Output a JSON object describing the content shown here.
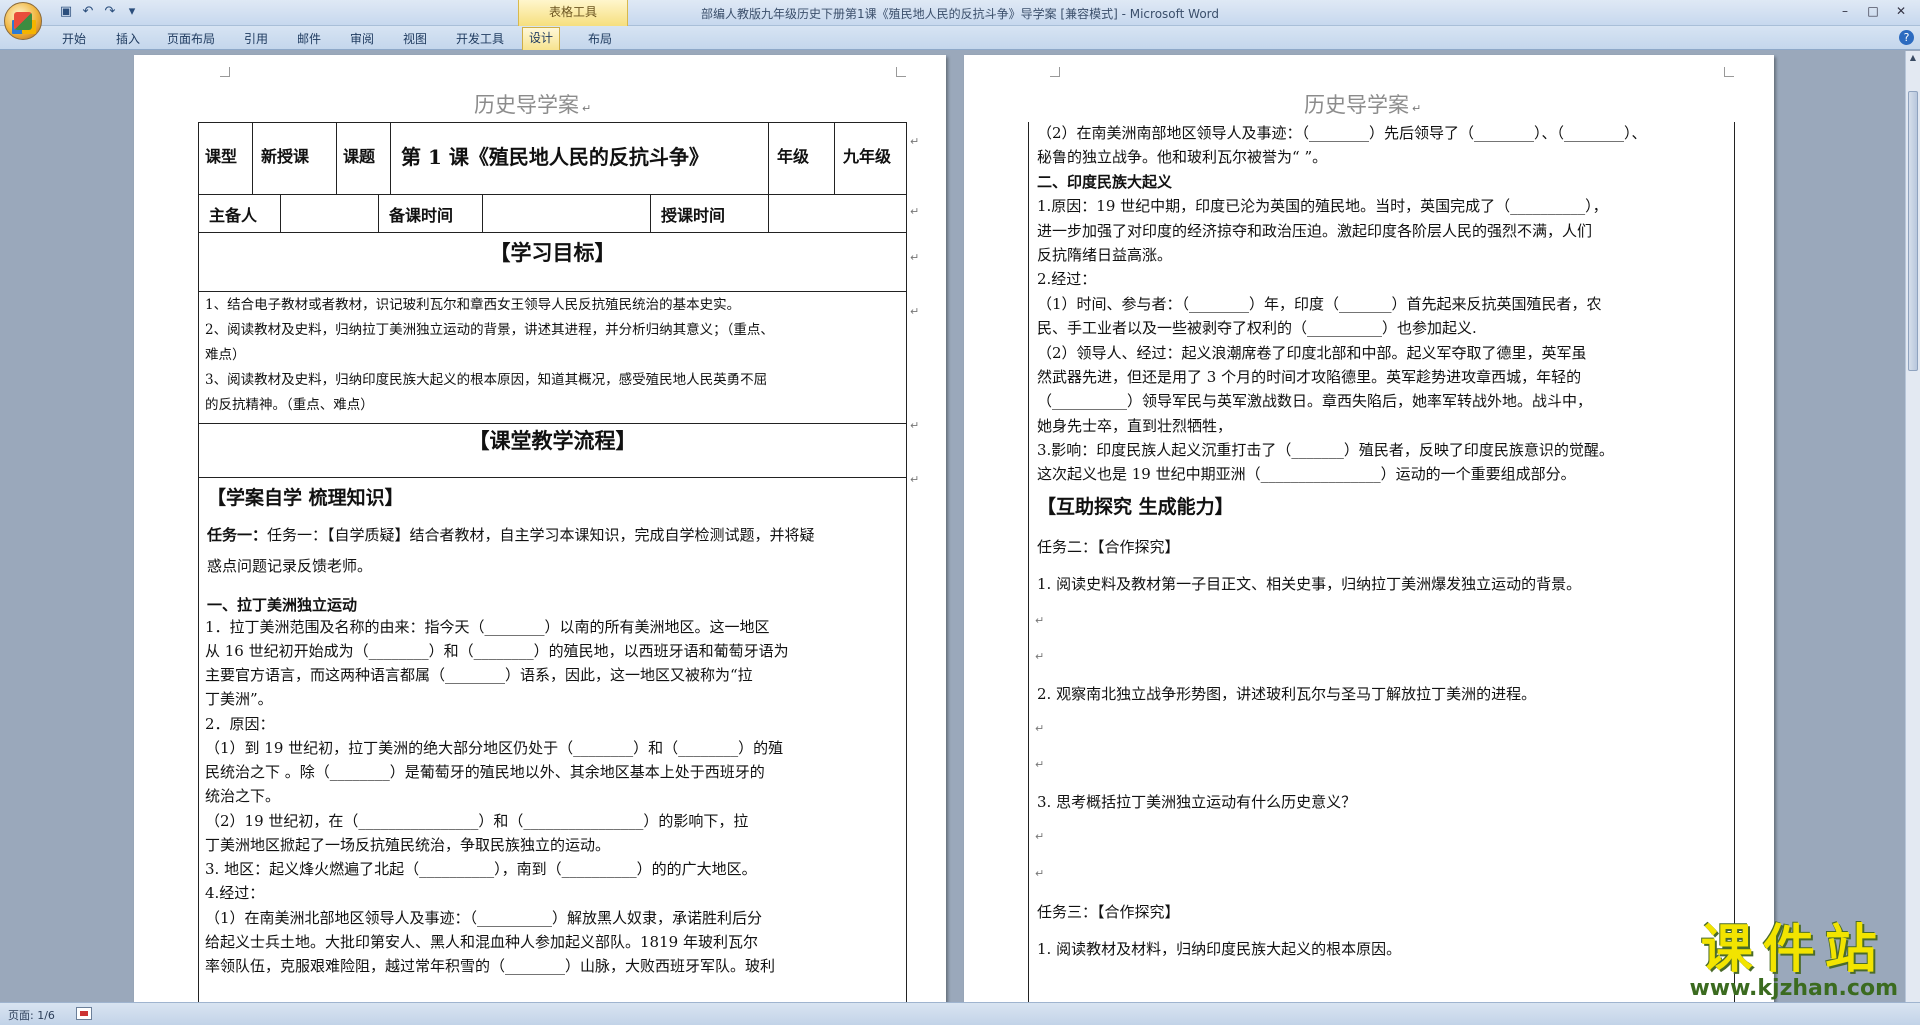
{
  "window": {
    "title": "部编人教版九年级历史下册第1课《殖民地人民的反抗斗争》导学案 [兼容模式] - Microsoft Word",
    "context_group": "表格工具",
    "controls": [
      "–",
      "□",
      "✕"
    ]
  },
  "ribbon": {
    "tabs": [
      "开始",
      "插入",
      "页面布局",
      "引用",
      "邮件",
      "审阅",
      "视图",
      "开发工具",
      "设计",
      "布局"
    ],
    "active_tab": "设计"
  },
  "page1": {
    "header": "历史导学案",
    "table": {
      "row1": [
        "课型",
        "新授课",
        "课题",
        "第 1 课《殖民地人民的反抗斗争》",
        "年级",
        "九年级"
      ],
      "row2": [
        "主备人",
        "",
        "备课时间",
        "",
        "授课时间",
        ""
      ],
      "goals_title": "【学习目标】",
      "goals": [
        "1、结合电子教材或者教材，识记玻利瓦尔和章西女王领导人民反抗殖民统治的基本史实。",
        "2、阅读教材及史料，归纳拉丁美洲独立运动的背景，讲述其进程，并分析归纳其意义；（重点、",
        "难点）",
        "3、阅读教材及史料，归纳印度民族大起义的根本原因，知道其概况，感受殖民地人民英勇不屈",
        "的反抗精神。（重点、难点）"
      ],
      "flow_title": "【课堂教学流程】"
    },
    "section_title": "【学案自学 梳理知识】",
    "task1": [
      "任务一：【自学质疑】结合者教材，自主学习本课知识，完成自学检测试题，并将疑",
      "惑点问题记录反馈老师。"
    ],
    "sub1": "一、拉丁美洲独立运动",
    "lines": [
      "1．拉丁美洲范围及名称的由来：指今天（________）以南的所有美洲地区。这一地区",
      "从 16 世纪初开始成为（________）和（________）的殖民地，以西班牙语和葡萄牙语为",
      "主要官方语言，而这两种语言都属（________）语系，因此，这一地区又被称为“拉",
      "丁美洲”。",
      "2．原因：",
      "（1）到 19 世纪初，拉丁美洲的绝大部分地区仍处于（________）和（________）的殖",
      "民统治之下 。除（________）是葡萄牙的殖民地以外、其余地区基本上处于西班牙的",
      "统治之下。",
      "（2）19 世纪初，在（________________）和（________________）的影响下，拉",
      "丁美洲地区掀起了一场反抗殖民统治，争取民族独立的运动。",
      "3. 地区：起义烽火燃遍了北起（__________），南到（__________）的的广大地区。",
      "4.经过：",
      "（1）在南美洲北部地区领导人及事迹：（__________）解放黑人奴隶，承诺胜利后分",
      "给起义士兵土地。大批印第安人、黑人和混血种人参加起义部队。1819 年玻利瓦尔",
      "率领队伍，克服艰难险阻，越过常年积雪的（________）山脉，大败西班牙军队。玻利"
    ]
  },
  "page2": {
    "header": "历史导学案",
    "lines_top": [
      "（2）在南美洲南部地区领导人及事迹：（________）先后领导了（________）、（________）、",
      "秘鲁的独立战争。他和玻利瓦尔被誉为“                              ”。"
    ],
    "sub2": "二、印度民族大起义",
    "lines_india": [
      "1.原因：19 世纪中期，印度已沦为英国的殖民地。当时，英国完成了（__________），",
      "进一步加强了对印度的经济掠夺和政治压迫。激起印度各阶层人民的强烈不满，人们",
      "反抗隋绪日益高涨。",
      "2.经过：",
      "（1）时间、参与者：（________）年，印度（_______）首先起来反抗英国殖民者，农",
      "民、手工业者以及一些被剥夺了权利的（__________）也参加起义.",
      "（2）领导人、经过：起义浪潮席卷了印度北部和中部。起义军夺取了德里，英军虽",
      "然武器先进，但还是用了 3 个月的时间才攻陷德里。英军趁势进攻章西城，年轻的",
      "（__________）领导军民与英军激战数日。章西失陷后，她率军转战外地。战斗中，",
      "她身先士卒，直到壮烈牺牲，",
      "3.影响：印度民族人起义沉重打击了（_______）殖民者，反映了印度民族意识的觉醒。",
      "这次起义也是 19 世纪中期亚洲（________________）运动的一个重要组成部分。"
    ],
    "section_title": "【互助探究 生成能力】",
    "task2": "任务二：【合作探究】",
    "q1": "1. 阅读史料及教材第一子目正文、相关史事，归纳拉丁美洲爆发独立运动的背景。",
    "q2": "2. 观察南北独立战争形势图，讲述玻利瓦尔与圣马丁解放拉丁美洲的进程。",
    "q3": "3. 思考概括拉丁美洲独立运动有什么历史意义？",
    "task3": "任务三：【合作探究】",
    "q4": "1. 阅读教材及材料，归纳印度民族大起义的根本原因。"
  },
  "status": {
    "page": "页面: 1/6"
  },
  "watermark": {
    "title": "课件站",
    "url": "www.kjzhan.com"
  }
}
